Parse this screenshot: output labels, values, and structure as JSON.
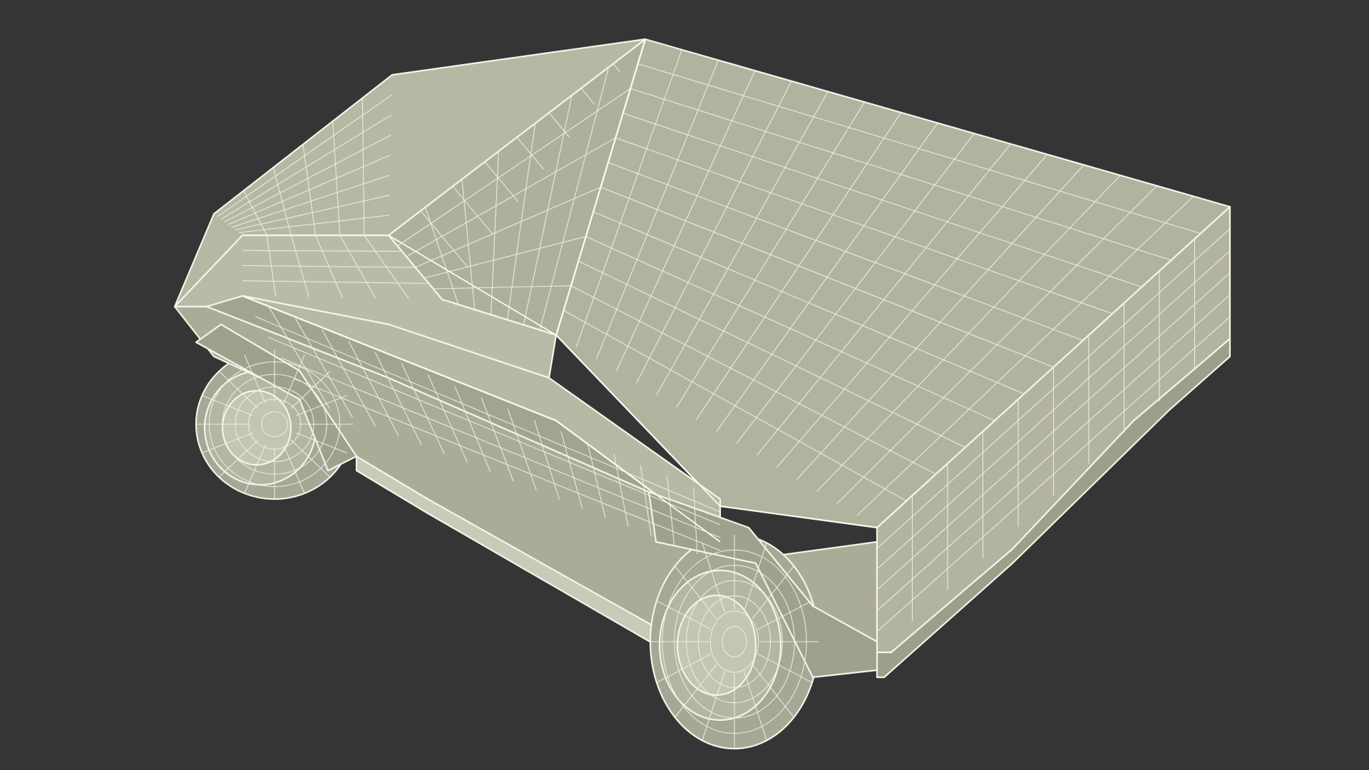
{
  "viewport": {
    "background_color": "#353535"
  },
  "model": {
    "subject": "truck-wireframe",
    "base_color": "#b2b39e",
    "shade_light": "#babba7",
    "shade_mid": "#abac98",
    "shade_dark": "#9c9d8a",
    "underside_color": "#c9cab8",
    "wire_color": "#f4f4ea"
  }
}
